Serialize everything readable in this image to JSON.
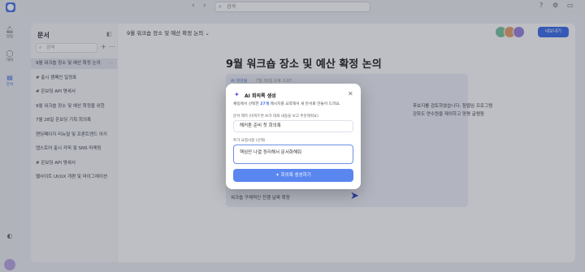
{
  "topbar": {
    "search_placeholder": "검색",
    "icons": [
      "chevron-left-icon",
      "chevron-right-icon",
      "search-icon",
      "help-icon",
      "settings-icon",
      "window-icon"
    ]
  },
  "rail": {
    "items": [
      {
        "icon": "bell-icon",
        "label": "알림"
      },
      {
        "icon": "chat-icon",
        "label": "대화"
      },
      {
        "icon": "document-icon",
        "label": "문서"
      }
    ]
  },
  "sidebar": {
    "title": "문서",
    "search_placeholder": "검색",
    "documents": [
      "9월 워크숍 장소 및 예산 확정 논의",
      "# 출시 캠페인 일정표",
      "# 온보딩 API 명세서",
      "9월 워크숍 장소 및 예산 확정을 위한",
      "7월 28일 온보딩 기획 회의록",
      "랜딩페이지 리뉴얼 및 프론트엔드 아키",
      "앱스토어 출시 카피 및 SNS 마케팅",
      "# 온보딩 API 명세서",
      "웹사이트 UI/UX 개편 및 마이그레이션"
    ]
  },
  "main": {
    "breadcrumb": "9월 워크숍 장소 및 예산 확정 논의",
    "share_label": "내보내기",
    "doc_title": "9월 워크숍 장소 및 예산 확정 논의",
    "block_tag": "AI 생성됨",
    "block_meta": "7월 30일 오후 3:07",
    "block_lines": [
      "후보지를 검토하였습니다. 첨렬임 프로그램",
      "강화도 연수원을 제외하고 양평 글램핑"
    ],
    "block_bottom": "워크숍 구체적인 진행 날짜 확정"
  },
  "modal": {
    "title": "AI 회의록 생성",
    "desc_prefix": "채팅에서 선택한 ",
    "desc_count": "27개",
    "desc_suffix": " 메시지를 요약해서 새 문서로 만들어 드려요.",
    "title_label": "문서 제목 (비워두면 AI가 대화 내용을 보고 추천해줘요)",
    "title_value": "해커톤 준비 첫 회의록",
    "extra_label": "추가 요청사항 (선택)",
    "extra_value": "핵심만 나열 정리해서 문서화해줘",
    "submit_label": "회의록 생성하기"
  },
  "colors": {
    "accent": "#3b6ee8",
    "modal_button": "#5a86f0",
    "ai_purple": "#6c4be0"
  }
}
